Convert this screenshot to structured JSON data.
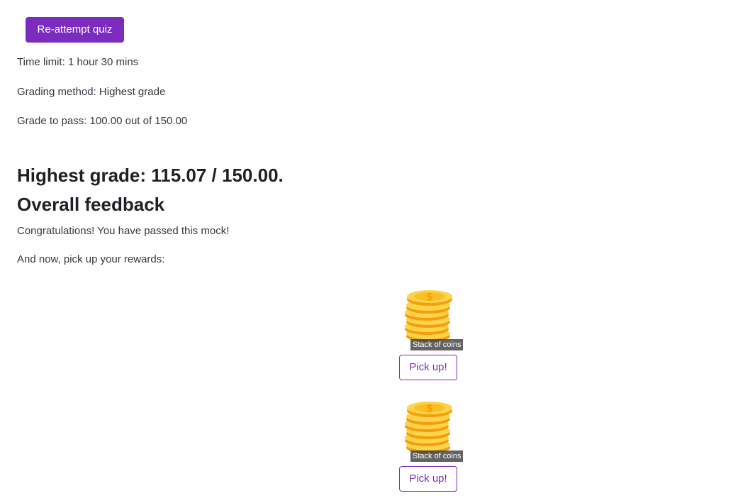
{
  "reattempt_button": "Re-attempt quiz",
  "info": {
    "time_limit": "Time limit: 1 hour 30 mins",
    "grading_method": "Grading method: Highest grade",
    "grade_to_pass": "Grade to pass: 100.00 out of 150.00"
  },
  "highest_grade": "Highest grade: 115.07 / 150.00.",
  "feedback": {
    "heading": "Overall feedback",
    "message": "Congratulations! You have passed this mock!",
    "prompt": "And now, pick up your rewards:"
  },
  "rewards": [
    {
      "caption": "Stack of coins",
      "button": "Pick up!",
      "icon": "coin-stack-icon"
    },
    {
      "caption": "Stack of coins",
      "button": "Pick up!",
      "icon": "coin-stack-icon"
    }
  ],
  "colors": {
    "accent": "#7b2cbf",
    "coin_light": "#fcd34d",
    "coin_dark": "#f59e0b"
  }
}
